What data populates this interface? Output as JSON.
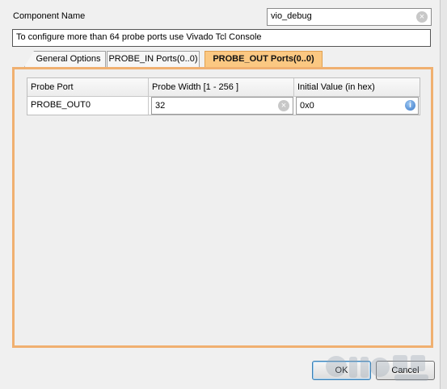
{
  "component": {
    "label": "Component Name",
    "value": "vio_debug"
  },
  "banner": "To configure more than 64 probe ports use Vivado Tcl Console",
  "tabs": [
    {
      "label": "General Options"
    },
    {
      "label": "PROBE_IN Ports(0..0)"
    },
    {
      "label": "PROBE_OUT Ports(0..0)"
    }
  ],
  "table": {
    "headers": [
      "Probe Port",
      "Probe Width [1 - 256 ]",
      "Initial Value (in hex)"
    ],
    "rows": [
      {
        "port": "PROBE_OUT0",
        "width": "32",
        "init": "0x0"
      }
    ]
  },
  "buttons": {
    "ok": "OK",
    "cancel": "Cancel"
  },
  "colors": {
    "active_tab": "#fbc882",
    "panel_border": "#f0b070"
  },
  "icons": {
    "clear": "clear-icon",
    "info": "info-icon"
  }
}
